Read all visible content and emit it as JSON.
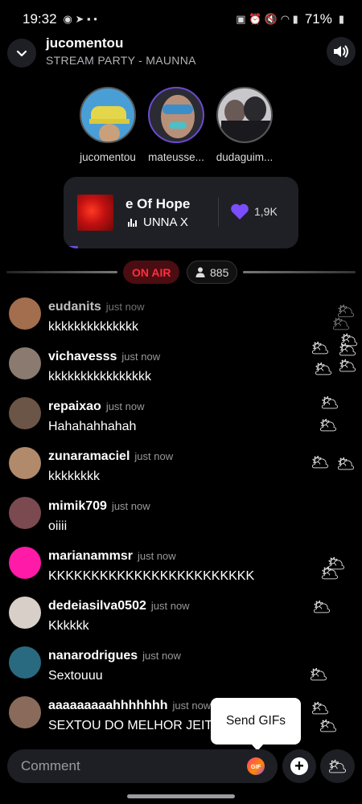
{
  "status_bar": {
    "time": "19:32",
    "battery": "71%"
  },
  "header": {
    "host": "jucomentou",
    "subtitle": "STREAM PARTY - MAUNNA"
  },
  "participants": [
    {
      "name": "jucomentou"
    },
    {
      "name": "mateusse..."
    },
    {
      "name": "dudaguim..."
    }
  ],
  "now_playing": {
    "title": "e Of Hope",
    "artist": "UNNA X",
    "likes": "1,9K",
    "progress_fraction": 0.06
  },
  "live": {
    "on_air": "ON AIR",
    "viewers": "885"
  },
  "chat": [
    {
      "user": "eudanits",
      "time": "just now",
      "text": "kkkkkkkkkkkkkk",
      "avatar_color": "#b47a55"
    },
    {
      "user": "vichavesss",
      "time": "just now",
      "text": "kkkkkkkkkkkkkkkk",
      "avatar_color": "#8a7a70"
    },
    {
      "user": "repaixao",
      "time": "just now",
      "text": "Hahahahhahah",
      "avatar_color": "#6b5546"
    },
    {
      "user": "zunaramaciel",
      "time": "just now",
      "text": "kkkkkkkk",
      "avatar_color": "#b08a6a"
    },
    {
      "user": "mimik709",
      "time": "just now",
      "text": "oiiii",
      "avatar_color": "#7a4a50"
    },
    {
      "user": "marianammsr",
      "time": "just now",
      "text": "KKKKKKKKKKKKKKKKKKKKKKKK",
      "avatar_color": "#ff1aa8"
    },
    {
      "user": "dedeiasilva0502",
      "time": "just now",
      "text": "Kkkkkk",
      "avatar_color": "#d8cfc8"
    },
    {
      "user": "nanarodrigues",
      "time": "just now",
      "text": "Sextouuu",
      "avatar_color": "#2a6a80"
    },
    {
      "user": "aaaaaaaaahhhhhhh",
      "time": "just now",
      "text": "SEXTOU DO MELHOR JEITO",
      "avatar_color": "#8a6a5a"
    }
  ],
  "tooltip": {
    "text": "Send GIFs"
  },
  "composer": {
    "placeholder": "Comment",
    "gif_label": "GIF",
    "plus_label": "+"
  },
  "reaction_emoji": "🌥",
  "colors": {
    "accent_purple": "#7b4dff",
    "on_air_red": "#ff2e3e",
    "background": "#000000"
  }
}
